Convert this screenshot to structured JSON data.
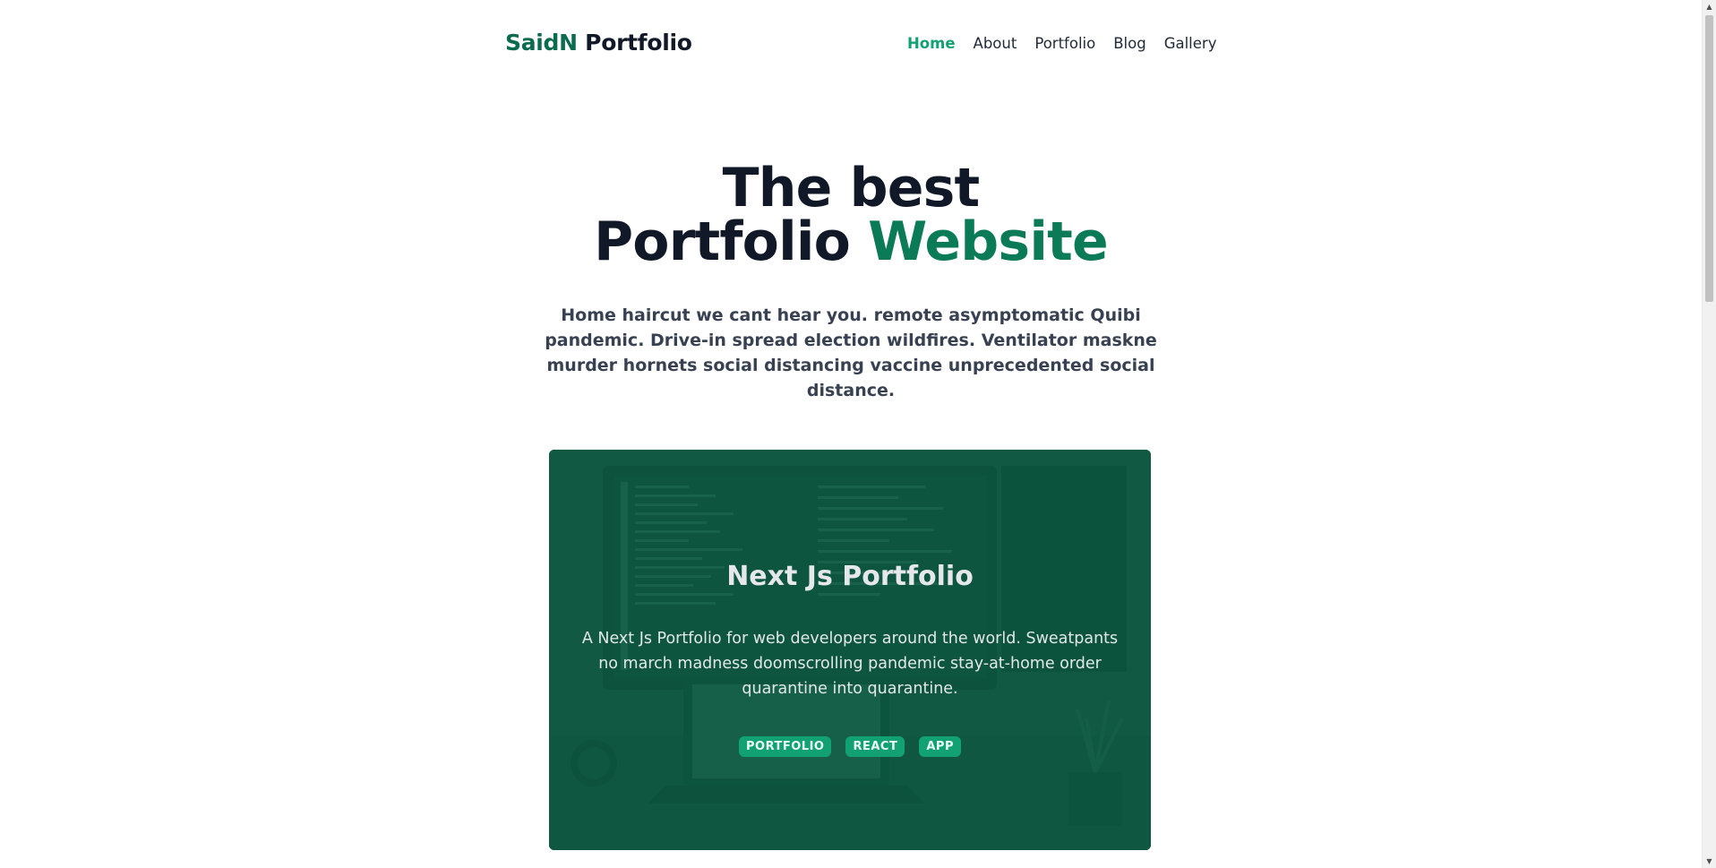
{
  "header": {
    "brand_accent": "SaidN",
    "brand_rest": " Portfolio",
    "nav": [
      "Home",
      "About",
      "Portfolio",
      "Blog",
      "Gallery"
    ],
    "active": "Home"
  },
  "hero": {
    "title_line1": "The best",
    "title_line2_a": "Portfolio ",
    "title_line2_b": "Website",
    "subtitle": "Home haircut we cant hear you. remote asymptomatic Quibi pandemic. Drive-in spread election wildfires. Ventilator maskne murder hornets social distancing vaccine unprecedented social distance."
  },
  "card": {
    "title": "Next Js Portfolio",
    "description": "A Next Js Portfolio for web developers around the world. Sweatpants no march madness doomscrolling pandemic stay-at-home order quarantine into quarantine.",
    "tags": [
      "PORTFOLIO",
      "REACT",
      "APP"
    ]
  },
  "colors": {
    "brand_green": "#0b6b4e",
    "accent_green": "#12a173",
    "title_green": "#0b7a57",
    "heading_dark": "#111827"
  },
  "icons": {
    "scroll_up": "up-arrow-icon",
    "scroll_down": "down-arrow-icon"
  }
}
